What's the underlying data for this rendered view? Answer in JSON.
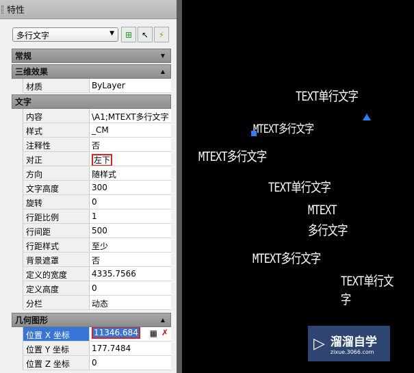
{
  "panel": {
    "title": "特性",
    "selector": "多行文字"
  },
  "categories": [
    {
      "name": "常规",
      "toggle": "▼",
      "rows": []
    },
    {
      "name": "三维效果",
      "toggle": "▲",
      "rows": [
        {
          "label": "材质",
          "value": "ByLayer"
        }
      ]
    },
    {
      "name": "文字",
      "toggle": "",
      "rows": [
        {
          "label": "内容",
          "value": "\\A1;MTEXT多行文字"
        },
        {
          "label": "样式",
          "value": "_CM"
        },
        {
          "label": "注释性",
          "value": "否"
        },
        {
          "label": "对正",
          "value": "左下"
        },
        {
          "label": "方向",
          "value": "随样式"
        },
        {
          "label": "文字高度",
          "value": "300"
        },
        {
          "label": "旋转",
          "value": "0"
        },
        {
          "label": "行距比例",
          "value": "1"
        },
        {
          "label": "行间距",
          "value": "500"
        },
        {
          "label": "行距样式",
          "value": "至少"
        },
        {
          "label": "背景遮罩",
          "value": "否"
        },
        {
          "label": "定义的宽度",
          "value": "4335.7566"
        },
        {
          "label": "定义高度",
          "value": "0"
        },
        {
          "label": "分栏",
          "value": "动态"
        }
      ]
    },
    {
      "name": "几何图形",
      "toggle": "▲",
      "rows": [
        {
          "label": "位置 X 坐标",
          "value": "11346.684"
        },
        {
          "label": "位置 Y 坐标",
          "value": "177.7484"
        },
        {
          "label": "位置 Z 坐标",
          "value": "0"
        }
      ]
    }
  ],
  "canvas": {
    "texts": [
      "TEXT单行文字",
      "MTEXT多行文字",
      "MTEXT多行文字",
      "TEXT单行文字",
      "MTEXT",
      "多行文字",
      "MTEXT多行文字",
      "TEXT单行文字"
    ]
  },
  "watermark": {
    "name": "溜溜自学",
    "url": "zixue.3066.com"
  }
}
